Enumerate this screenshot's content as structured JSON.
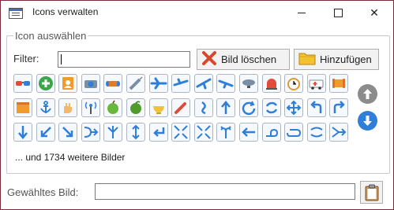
{
  "window": {
    "title": "Icons verwalten",
    "close_glyph": "✕"
  },
  "group": {
    "label": "Icon auswählen"
  },
  "filter": {
    "label": "Filter:",
    "value": ""
  },
  "buttons": {
    "delete_label": "Bild löschen",
    "add_label": "Hinzufügen"
  },
  "icons": [
    [
      "glasses-icon",
      "add-green-icon",
      "address-book-icon",
      "camera-icon",
      "cylinder-icon",
      "syringe-icon",
      "airplane-icon",
      "airplane-2-icon",
      "airplane-3-icon",
      "airplane-4-icon",
      "airship-icon",
      "alarm-light-icon",
      "alarm-clock-icon",
      "ambulance-icon",
      "scroll-icon"
    ],
    [
      "book-orange-icon",
      "anchor-icon",
      "hand-icon",
      "antenna-icon",
      "apple-icon",
      "apple-2-icon",
      "bowl-icon",
      "pen-icon",
      "arrow-curve-icon",
      "arrow-up-icon",
      "arrow-circle-icon",
      "arrows-refresh-icon",
      "arrows-move-icon",
      "arrow-turn-left-icon",
      "arrow-turn-right-icon"
    ],
    [
      "arrow-down-icon",
      "arrow-down-left-icon",
      "arrow-down-right-icon",
      "arrows-merge-icon",
      "arrows-split-icon",
      "arrow-up-down-icon",
      "arrow-return-icon",
      "arrows-collapse-icon",
      "arrows-expand-icon",
      "arrow-fork-icon",
      "arrow-left-icon",
      "arrow-loop-icon",
      "arrow-cycle-icon",
      "arrows-swap-icon",
      "arrow-join-right-icon"
    ]
  ],
  "side_buttons": {
    "up_icon": "scroll-up-icon",
    "down_icon": "scroll-down-icon"
  },
  "more_text": "... und 1734 weitere Bilder",
  "selected": {
    "label": "Gewähltes Bild:",
    "value": ""
  },
  "colors": {
    "window_border": "#7a2b3b",
    "icon_blue": "#2f7fd8",
    "delete_red": "#d9472b",
    "folder_yellow": "#f2c230"
  }
}
